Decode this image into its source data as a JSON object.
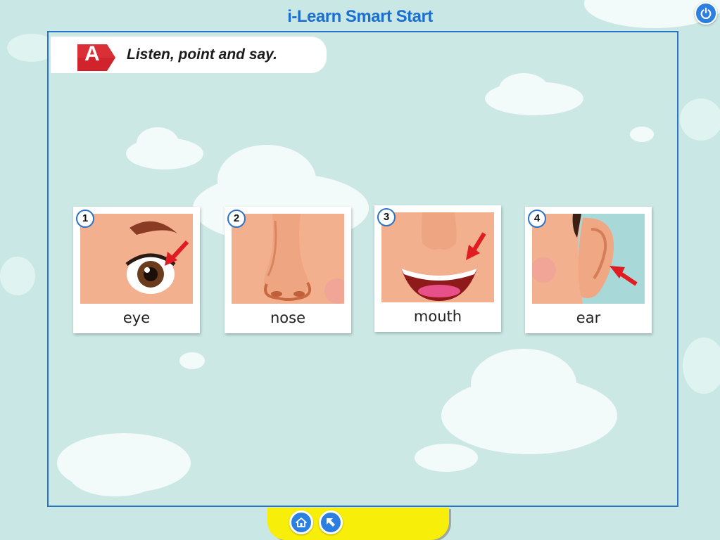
{
  "app": {
    "title": "i-Learn Smart Start"
  },
  "instruction": {
    "badge": "A",
    "text": "Listen, point and say."
  },
  "cards": [
    {
      "number": "1",
      "label": "eye"
    },
    {
      "number": "2",
      "label": "nose"
    },
    {
      "number": "3",
      "label": "mouth"
    },
    {
      "number": "4",
      "label": "ear"
    }
  ],
  "colors": {
    "accent": "#2b7fe0",
    "badge": "#d0232c",
    "footer": "#f7ef0a",
    "skin": "#f3b08e"
  },
  "icons": {
    "power": "power-icon",
    "home": "home-icon",
    "back": "back-arrow-icon",
    "pointer": "red-arrow-icon"
  }
}
